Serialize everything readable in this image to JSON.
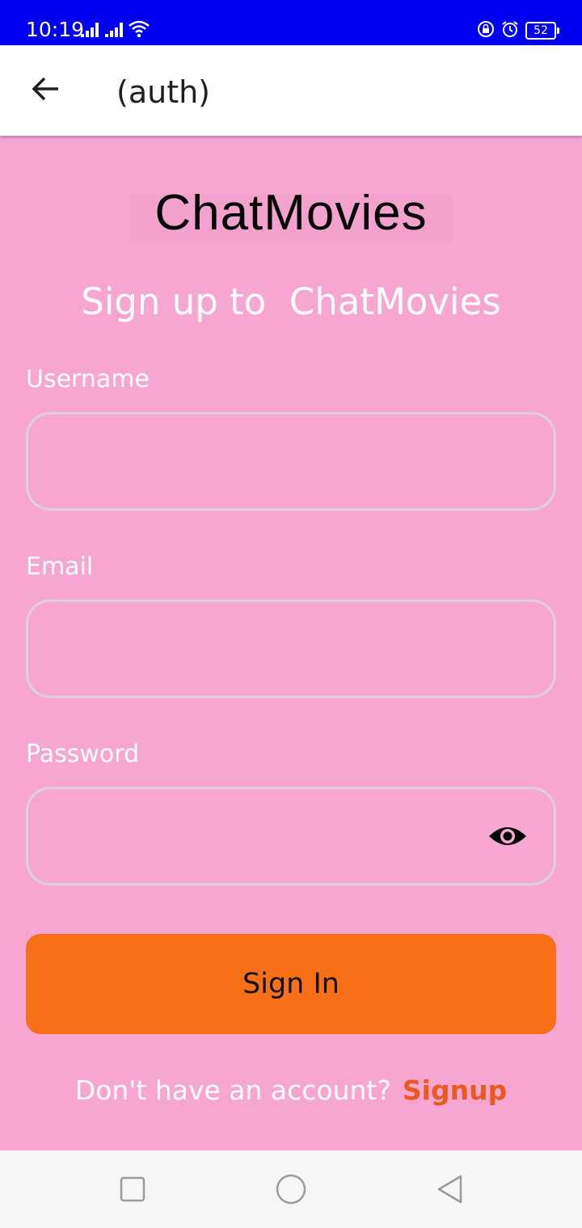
{
  "status_bar": {
    "time": "10:19",
    "battery": "52",
    "icons": [
      "signal-icon",
      "signal-icon",
      "wifi-icon",
      "lock-rotation-icon",
      "alarm-icon",
      "battery-icon"
    ]
  },
  "app_bar": {
    "title": "(auth)",
    "back_icon": "arrow-left-icon"
  },
  "logo": {
    "text": "ChatMovies"
  },
  "headline": "Sign up to  ChatMovies",
  "form": {
    "username": {
      "label": "Username",
      "value": ""
    },
    "email": {
      "label": "Email",
      "value": ""
    },
    "password": {
      "label": "Password",
      "value": "",
      "toggle_icon": "eye-icon"
    }
  },
  "primary_button": {
    "label": "Sign In"
  },
  "footer": {
    "prompt": "Don't have an account?",
    "link": "Signup"
  },
  "nav_bar": {
    "icons": [
      "square-icon",
      "circle-icon",
      "triangle-back-icon"
    ]
  },
  "colors": {
    "status_bar": "#0000f0",
    "background": "#f7a6d2",
    "button": "#f77018",
    "link": "#ea5a1f",
    "field_border": "#d9d2dc"
  }
}
